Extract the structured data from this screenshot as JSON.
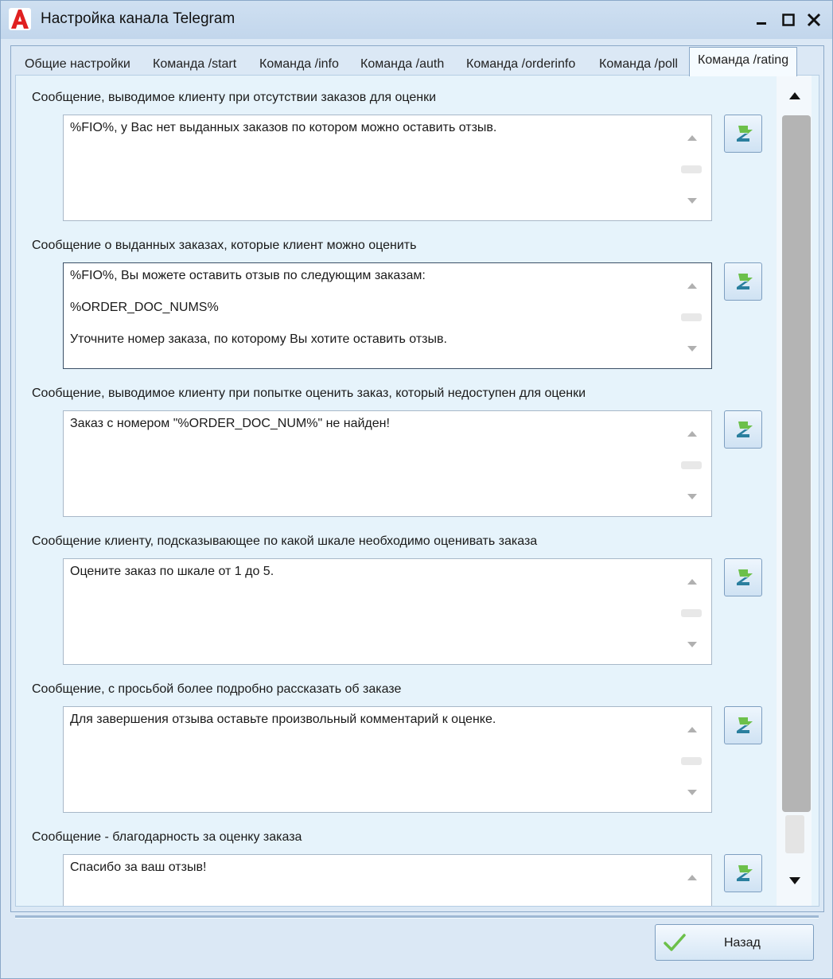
{
  "window": {
    "title": "Настройка канала Telegram",
    "app_icon": "app-logo-a-icon",
    "controls": {
      "minimize": "minimize-icon",
      "maximize": "maximize-icon",
      "close": "close-icon"
    }
  },
  "tabs": [
    {
      "label": "Общие настройки",
      "active": false
    },
    {
      "label": "Команда /start",
      "active": false
    },
    {
      "label": "Команда /info",
      "active": false
    },
    {
      "label": "Команда /auth",
      "active": false
    },
    {
      "label": "Команда /orderinfo",
      "active": false
    },
    {
      "label": "Команда /poll",
      "active": false
    },
    {
      "label": "Команда /rating",
      "active": true
    }
  ],
  "sections": [
    {
      "label": "Сообщение, выводимое клиенту при отсутствии заказов для оценки",
      "text": "%FIO%, у Вас нет выданных заказов по котором можно оставить отзыв."
    },
    {
      "label": "Сообщение о выданных заказах, которые клиент можно оценить",
      "text": "%FIO%, Вы можете оставить отзыв по следующим заказам:\n\n%ORDER_DOC_NUMS%\n\nУточните номер заказа, по которому Вы хотите оставить отзыв."
    },
    {
      "label": "Сообщение, выводимое клиенту при попытке оценить заказ, который недоступен для оценки",
      "text": "Заказ с номером \"%ORDER_DOC_NUM%\" не найден!"
    },
    {
      "label": "Сообщение клиенту, подсказывающее по какой шкале необходимо оценивать заказа",
      "text": "Оцените заказ по шкале от 1 до 5."
    },
    {
      "label": "Сообщение, с просьбой более подробно рассказать об заказе",
      "text": "Для завершения отзыва оставьте произвольный комментарий к оценке."
    },
    {
      "label": "Сообщение - благодарность за оценку заказа",
      "text": "Спасибо за ваш отзыв!"
    }
  ],
  "footer": {
    "back_label": "Назад",
    "back_icon": "checkmark-icon"
  },
  "colors": {
    "accent_green": "#6cc04a",
    "button_teal": "#2a9d8f",
    "border": "#8aa8c8"
  }
}
